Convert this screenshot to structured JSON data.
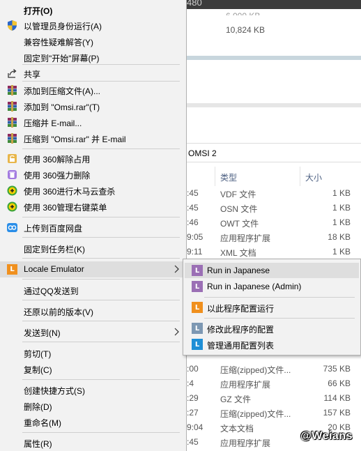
{
  "background": {
    "title_fragment": "480",
    "size_fragment": "6,000 KB",
    "size_value": "10,824 KB",
    "path_label": "OMSI 2",
    "columns": {
      "type": "类型",
      "size": "大小"
    },
    "rows": [
      {
        "time": ":45",
        "type": "VDF 文件",
        "size": "1 KB"
      },
      {
        "time": ":45",
        "type": "OSN 文件",
        "size": "1 KB"
      },
      {
        "time": ":46",
        "type": "OWT 文件",
        "size": "1 KB"
      },
      {
        "time": "9:05",
        "type": "应用程序扩展",
        "size": "18 KB"
      },
      {
        "time": "9:11",
        "type": "XML 文档",
        "size": "1 KB"
      },
      {
        "time": ":00",
        "type": "压缩(zipped)文件...",
        "size": "735 KB"
      },
      {
        "time": ":4",
        "type": "应用程序扩展",
        "size": "66 KB"
      },
      {
        "time": ":29",
        "type": "GZ 文件",
        "size": "114 KB"
      },
      {
        "time": ":27",
        "type": "压缩(zipped)文件...",
        "size": "157 KB"
      },
      {
        "time": "9:04",
        "type": "文本文档",
        "size": "20 KB"
      },
      {
        "time": ":45",
        "type": "应用程序扩展",
        "size": ""
      }
    ],
    "watermark": "@Weians"
  },
  "menu": {
    "items": [
      {
        "label": "打开(O)",
        "icon": ""
      },
      {
        "label": "以管理员身份运行(A)",
        "icon": "uac-shield-icon"
      },
      {
        "label": "兼容性疑难解答(Y)",
        "icon": ""
      },
      {
        "label": "固定到\"开始\"屏幕(P)",
        "icon": ""
      },
      {
        "label": "共享",
        "icon": "share-icon"
      },
      {
        "label": "添加到压缩文件(A)...",
        "icon": "winrar-icon"
      },
      {
        "label": "添加到 \"Omsi.rar\"(T)",
        "icon": "winrar-icon"
      },
      {
        "label": "压缩并 E-mail...",
        "icon": "winrar-icon"
      },
      {
        "label": "压缩到 \"Omsi.rar\" 并 E-mail",
        "icon": "winrar-icon"
      },
      {
        "label": "使用 360解除占用",
        "icon": "360-unlock-icon"
      },
      {
        "label": "使用 360强力删除",
        "icon": "360-delete-icon"
      },
      {
        "label": "使用 360进行木马云查杀",
        "icon": "360-scan-icon"
      },
      {
        "label": "使用 360管理右键菜单",
        "icon": "360-menu-icon"
      },
      {
        "label": "上传到百度网盘",
        "icon": "baidu-cloud-icon"
      },
      {
        "label": "固定到任务栏(K)",
        "icon": ""
      },
      {
        "label": "Locale Emulator",
        "icon": "locale-emulator-icon"
      },
      {
        "label": "通过QQ发送到",
        "icon": ""
      },
      {
        "label": "还原以前的版本(V)",
        "icon": ""
      },
      {
        "label": "发送到(N)",
        "icon": ""
      },
      {
        "label": "剪切(T)",
        "icon": ""
      },
      {
        "label": "复制(C)",
        "icon": ""
      },
      {
        "label": "创建快捷方式(S)",
        "icon": ""
      },
      {
        "label": "删除(D)",
        "icon": ""
      },
      {
        "label": "重命名(M)",
        "icon": ""
      },
      {
        "label": "属性(R)",
        "icon": ""
      }
    ]
  },
  "submenu": {
    "items": [
      {
        "label": "Run in Japanese",
        "color": "#9b6fb5"
      },
      {
        "label": "Run in Japanese (Admin)",
        "color": "#9b6fb5"
      },
      {
        "label": "以此程序配置运行",
        "color": "#f0901e"
      },
      {
        "label": "修改此程序的配置",
        "color": "#7d98b3"
      },
      {
        "label": "管理通用配置列表",
        "color": "#1f8fd6"
      }
    ]
  }
}
